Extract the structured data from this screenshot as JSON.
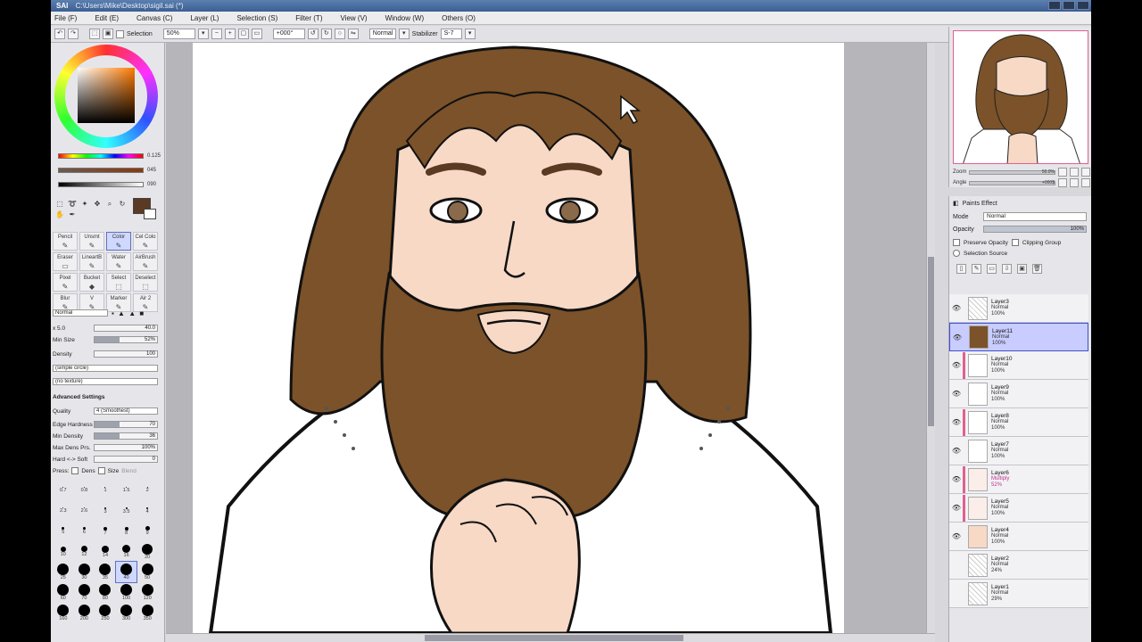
{
  "window": {
    "app_logo": "SAI",
    "title": "C:\\Users\\Mike\\Desktop\\sigil.sai (*)"
  },
  "menu": [
    "File (F)",
    "Edit (E)",
    "Canvas (C)",
    "Layer (L)",
    "Selection (S)",
    "Filter (T)",
    "View (V)",
    "Window (W)",
    "Others (O)"
  ],
  "toolbar": {
    "selection_label": "Selection",
    "zoom": "50%",
    "rotation": "+000°",
    "blend_mode": "Normal",
    "stabilizer_label": "Stabilizer",
    "stabilizer_value": "S-7"
  },
  "color_panel": {
    "slider_values": [
      "0.125",
      "045",
      "090"
    ],
    "colors": {
      "primary": "#5a3a22",
      "secondary": "#ffffff"
    }
  },
  "tools": {
    "brushes": [
      {
        "label": "Pencil",
        "icon": "✎"
      },
      {
        "label": "Unsmt",
        "icon": "✎"
      },
      {
        "label": "Color",
        "icon": "✎"
      },
      {
        "label": "Cel Colo",
        "icon": "✎"
      },
      {
        "label": "Eraser",
        "icon": "▭"
      },
      {
        "label": "LineartB",
        "icon": "✎"
      },
      {
        "label": "Water",
        "icon": "✎"
      },
      {
        "label": "AirBrush",
        "icon": "✎"
      },
      {
        "label": "Pixel",
        "icon": "✎"
      },
      {
        "label": "Bucket",
        "icon": "◆"
      },
      {
        "label": "Select",
        "icon": "⬚"
      },
      {
        "label": "Deselect",
        "icon": "⬚"
      },
      {
        "label": "Blur",
        "icon": "✎"
      },
      {
        "label": "V",
        "icon": "✎"
      },
      {
        "label": "Marker",
        "icon": "✎"
      },
      {
        "label": "Air 2",
        "icon": "✎"
      }
    ],
    "active_brush_index": 2
  },
  "brush_props": {
    "blend": "Normal",
    "size_range": "x 5.0",
    "size_value": "40.0",
    "min_size_label": "Min Size",
    "min_size": "52%",
    "density_label": "Density",
    "density": "100",
    "shape": "(simple circle)",
    "texture": "(no texture)",
    "advanced_label": "Advanced Settings",
    "quality_label": "Quality",
    "quality": "4 (Smoothest)",
    "edge_label": "Edge Hardness",
    "edge": "70",
    "min_density_label": "Min Density",
    "min_density": "36",
    "max_dens_label": "Max Dens Prs.",
    "max_dens": "100%",
    "hard_soft_label": "Hard <-> Soft",
    "hard_soft": "0",
    "press_label": "Press:",
    "dens_label": "Dens",
    "size_label": "Size",
    "blend_label": "Blend"
  },
  "brush_sizes": [
    {
      "label": "0.7",
      "d": 1
    },
    {
      "label": "0.8",
      "d": 1
    },
    {
      "label": "1",
      "d": 1
    },
    {
      "label": "1.5",
      "d": 1
    },
    {
      "label": "2",
      "d": 1
    },
    {
      "label": "2.3",
      "d": 1
    },
    {
      "label": "2.6",
      "d": 1
    },
    {
      "label": "3",
      "d": 2
    },
    {
      "label": "3.5",
      "d": 2
    },
    {
      "label": "4",
      "d": 2
    },
    {
      "label": "5",
      "d": 3
    },
    {
      "label": "6",
      "d": 3
    },
    {
      "label": "7",
      "d": 4
    },
    {
      "label": "8",
      "d": 4
    },
    {
      "label": "9",
      "d": 5
    },
    {
      "label": "10",
      "d": 6
    },
    {
      "label": "12",
      "d": 7
    },
    {
      "label": "14",
      "d": 8
    },
    {
      "label": "16",
      "d": 9
    },
    {
      "label": "20",
      "d": 12
    },
    {
      "label": "25",
      "d": 13
    },
    {
      "label": "30",
      "d": 13
    },
    {
      "label": "35",
      "d": 13
    },
    {
      "label": "40",
      "d": 13
    },
    {
      "label": "50",
      "d": 13
    },
    {
      "label": "60",
      "d": 13
    },
    {
      "label": "70",
      "d": 13
    },
    {
      "label": "80",
      "d": 13
    },
    {
      "label": "100",
      "d": 13
    },
    {
      "label": "120",
      "d": 13
    },
    {
      "label": "160",
      "d": 13
    },
    {
      "label": "200",
      "d": 13
    },
    {
      "label": "250",
      "d": 13
    },
    {
      "label": "300",
      "d": 13
    },
    {
      "label": "350",
      "d": 13
    }
  ],
  "active_size_index": 23,
  "navigator": {
    "zoom_label": "Zoom",
    "zoom_value": "50.0%",
    "angle_label": "Angle",
    "angle_value": "+000$"
  },
  "layer_panel": {
    "paint_effect_label": "Paints Effect",
    "mode_label": "Mode",
    "mode_value": "Normal",
    "opacity_label": "Opacity",
    "opacity_value": "100%",
    "preserve_opacity": "Preserve Opacity",
    "clipping_group": "Clipping Group",
    "selection_source": "Selection Source",
    "layers": [
      {
        "name": "Layer3",
        "mode": "Normal",
        "opacity": "100%",
        "visible": true,
        "selected": false,
        "mark": "",
        "thumb": "lines"
      },
      {
        "name": "Layer11",
        "mode": "Normal",
        "opacity": "100%",
        "visible": true,
        "selected": true,
        "mark": "",
        "thumb": "hair"
      },
      {
        "name": "Layer10",
        "mode": "Normal",
        "opacity": "100%",
        "visible": true,
        "selected": false,
        "mark": "#e06090",
        "thumb": "blank"
      },
      {
        "name": "Layer9",
        "mode": "Normal",
        "opacity": "100%",
        "visible": true,
        "selected": false,
        "mark": "",
        "thumb": "blank"
      },
      {
        "name": "Layer8",
        "mode": "Normal",
        "opacity": "100%",
        "visible": true,
        "selected": false,
        "mark": "#e06090",
        "thumb": "blank"
      },
      {
        "name": "Layer7",
        "mode": "Normal",
        "opacity": "100%",
        "visible": true,
        "selected": false,
        "mark": "",
        "thumb": "blank"
      },
      {
        "name": "Layer6",
        "mode": "Multiply",
        "opacity": "52%",
        "visible": true,
        "selected": false,
        "mark": "#e06090",
        "thumb": "faint"
      },
      {
        "name": "Layer5",
        "mode": "Normal",
        "opacity": "100%",
        "visible": true,
        "selected": false,
        "mark": "#e06090",
        "thumb": "faint"
      },
      {
        "name": "Layer4",
        "mode": "Normal",
        "opacity": "100%",
        "visible": true,
        "selected": false,
        "mark": "",
        "thumb": "skin"
      },
      {
        "name": "Layer2",
        "mode": "Normal",
        "opacity": "24%",
        "visible": false,
        "selected": false,
        "mark": "",
        "thumb": "lines"
      },
      {
        "name": "Layer1",
        "mode": "Normal",
        "opacity": "29%",
        "visible": false,
        "selected": false,
        "mark": "",
        "thumb": "lines"
      }
    ]
  }
}
